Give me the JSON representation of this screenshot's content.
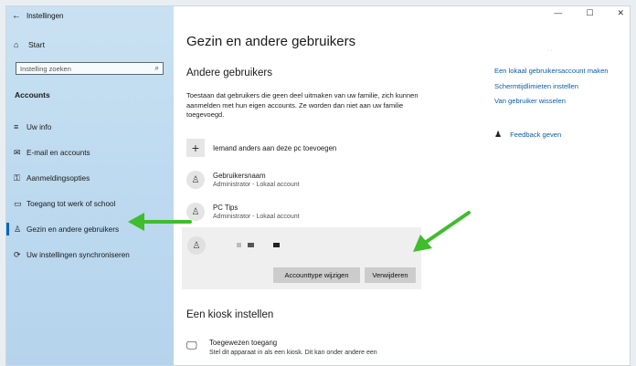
{
  "window": {
    "title": "Instellingen",
    "controls": [
      "—",
      "☐",
      "✕"
    ]
  },
  "sidebar": {
    "home": "Start",
    "search_placeholder": "Instelling zoeken",
    "section": "Accounts",
    "items": [
      {
        "label": "Uw info",
        "icon": "≡"
      },
      {
        "label": "E-mail en accounts",
        "icon": "✉"
      },
      {
        "label": "Aanmeldingsopties",
        "icon": "⚿"
      },
      {
        "label": "Toegang tot werk of school",
        "icon": "▭"
      },
      {
        "label": "Gezin en andere gebruikers",
        "icon": "♙"
      },
      {
        "label": "Uw instellingen synchroniseren",
        "icon": "⟳"
      }
    ]
  },
  "main": {
    "title": "Gezin en andere gebruikers",
    "other_users_heading": "Andere gebruikers",
    "description": "Toestaan dat gebruikers die geen deel uitmaken van uw familie, zich kunnen aanmelden met hun eigen accounts. Ze worden dan niet aan uw familie toegevoegd.",
    "add_label": "Iemand anders aan deze pc toevoegen",
    "users": [
      {
        "name": "Gebruikersnaam",
        "role": "Administrator - Lokaal account"
      },
      {
        "name": "PC Tips",
        "role": "Administrator - Lokaal account"
      }
    ],
    "buttons": {
      "change_type": "Accounttype wijzigen",
      "remove": "Verwijderen"
    },
    "kiosk_heading": "Een kiosk instellen",
    "kiosk_title": "Toegewezen toegang",
    "kiosk_desc": "Stel dit apparaat in als een kiosk. Dit kan onder andere een"
  },
  "related": {
    "links": [
      "Een lokaal gebruikersaccount maken",
      "Schermtijdlimieten instellen",
      "Van gebruiker wisselen"
    ],
    "feedback": "Feedback geven"
  },
  "colors": {
    "accent": "#0067c0",
    "link": "#0b5cad",
    "arrow": "#3fbd2c"
  }
}
